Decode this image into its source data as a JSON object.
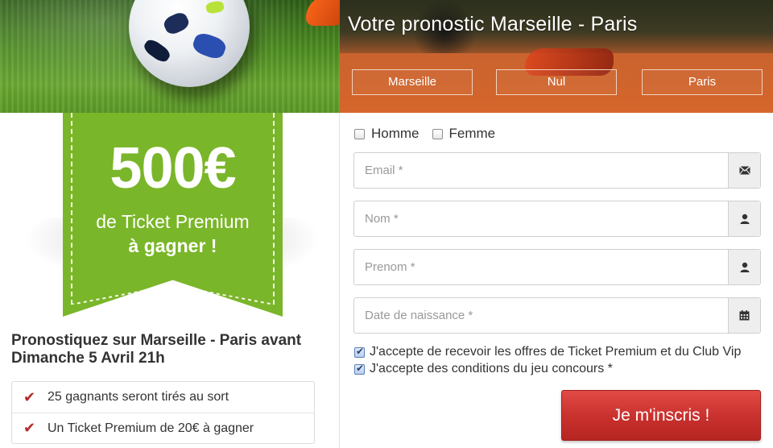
{
  "header": {
    "title": "Votre pronostic Marseille - Paris",
    "choices": [
      {
        "label": "Marseille"
      },
      {
        "label": "Nul"
      },
      {
        "label": "Paris"
      }
    ]
  },
  "promo": {
    "amount": "500€",
    "line1": "de Ticket Premium",
    "line2": "à gagner !",
    "deadline": "Pronostiquez sur Marseille - Paris avant Dimanche 5 Avril 21h",
    "benefits": [
      {
        "text": "25 gagnants seront tirés au sort",
        "icon": "check-icon"
      },
      {
        "text": "Un Ticket Premium de 20€ à gagner",
        "icon": "check-icon"
      }
    ]
  },
  "form": {
    "gender": [
      {
        "label": "Homme",
        "checked": false
      },
      {
        "label": "Femme",
        "checked": false
      }
    ],
    "fields": [
      {
        "placeholder": "Email *",
        "icon": "envelope-icon"
      },
      {
        "placeholder": "Nom *",
        "icon": "user-icon"
      },
      {
        "placeholder": "Prenom *",
        "icon": "user-icon"
      },
      {
        "placeholder": "Date de naissance *",
        "icon": "calendar-icon"
      }
    ],
    "consents": [
      {
        "label": "J'accepte de recevoir les offres de Ticket Premium et du Club Vip",
        "checked": true
      },
      {
        "label": "J'accepte des conditions du jeu concours *",
        "checked": true
      }
    ],
    "submit_label": "Je m'inscris !"
  },
  "colors": {
    "ribbon_green": "#7ab629",
    "banner_orange": "#d6662b",
    "submit_red": "#c8302d",
    "check_red": "#b52a2a"
  }
}
